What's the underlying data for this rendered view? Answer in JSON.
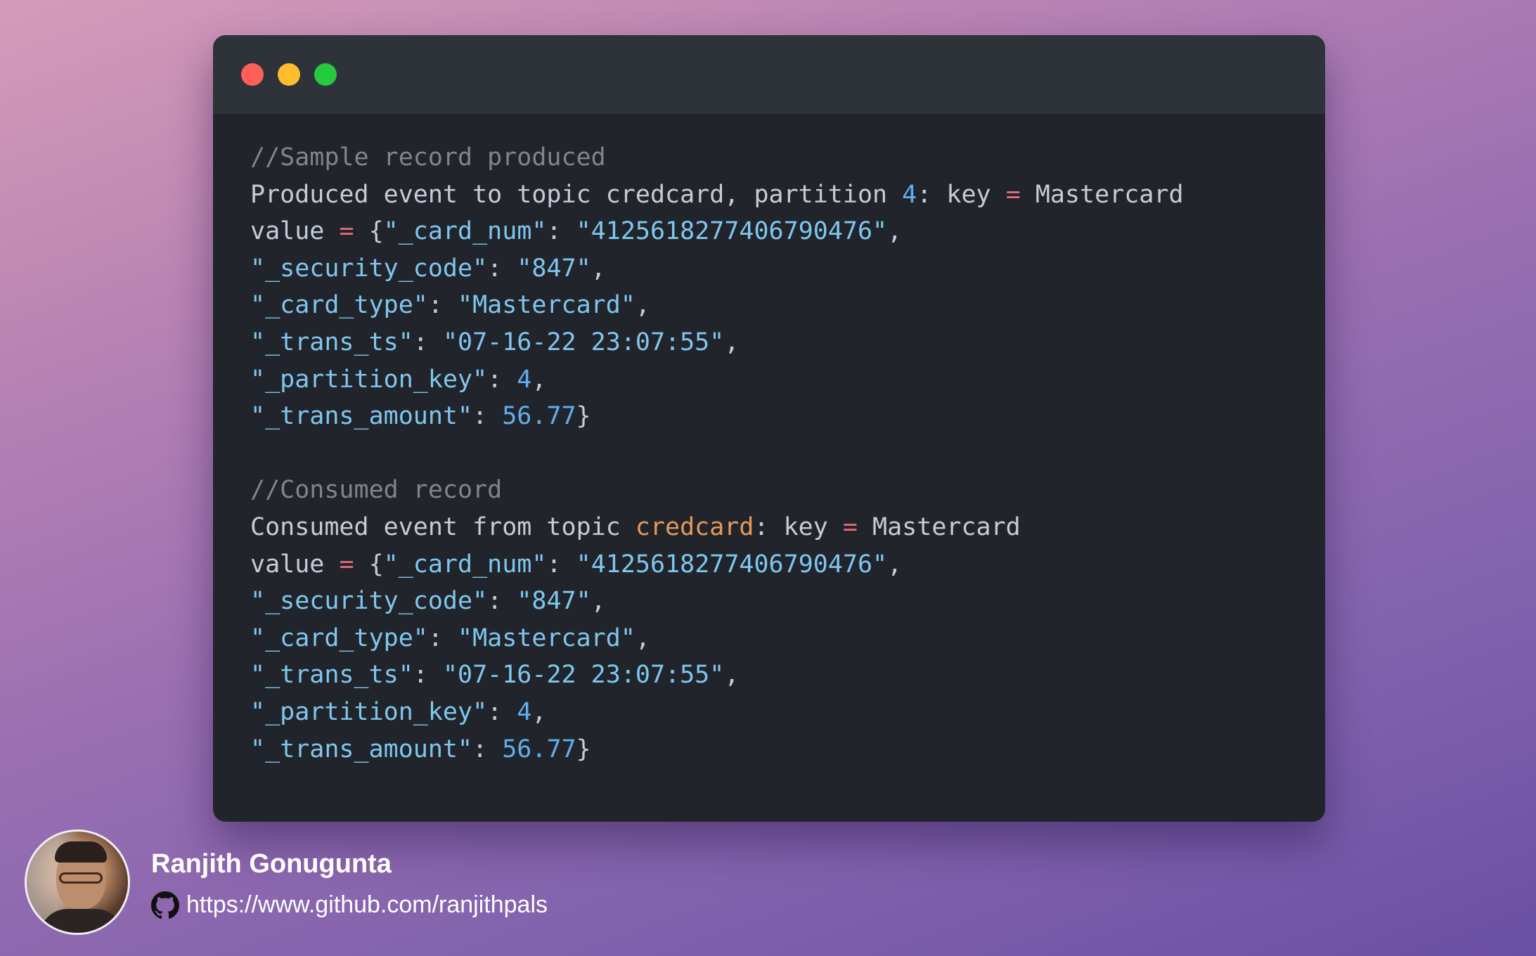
{
  "window": {
    "controls": [
      "close",
      "minimize",
      "maximize"
    ],
    "colors": {
      "close": "#ff5f56",
      "minimize": "#ffbd2e",
      "maximize": "#27c93f",
      "background": "#21252b"
    }
  },
  "code": {
    "lines": [
      [
        {
          "t": "//Sample record produced",
          "k": "c"
        }
      ],
      [
        {
          "t": "Produced event to topic credcard, partition ",
          "k": "p"
        },
        {
          "t": "4",
          "k": "n"
        },
        {
          "t": ": key ",
          "k": "p"
        },
        {
          "t": "=",
          "k": "o"
        },
        {
          "t": " Mastercard",
          "k": "p"
        }
      ],
      [
        {
          "t": "value ",
          "k": "p"
        },
        {
          "t": "=",
          "k": "o"
        },
        {
          "t": " {",
          "k": "p"
        },
        {
          "t": "\"_card_num\"",
          "k": "s"
        },
        {
          "t": ": ",
          "k": "p"
        },
        {
          "t": "\"4125618277406790476\"",
          "k": "s"
        },
        {
          "t": ",",
          "k": "p"
        }
      ],
      [
        {
          "t": "\"_security_code\"",
          "k": "s"
        },
        {
          "t": ": ",
          "k": "p"
        },
        {
          "t": "\"847\"",
          "k": "s"
        },
        {
          "t": ",",
          "k": "p"
        }
      ],
      [
        {
          "t": "\"_card_type\"",
          "k": "s"
        },
        {
          "t": ": ",
          "k": "p"
        },
        {
          "t": "\"Mastercard\"",
          "k": "s"
        },
        {
          "t": ",",
          "k": "p"
        }
      ],
      [
        {
          "t": "\"_trans_ts\"",
          "k": "s"
        },
        {
          "t": ": ",
          "k": "p"
        },
        {
          "t": "\"07-16-22 23:07:55\"",
          "k": "s"
        },
        {
          "t": ",",
          "k": "p"
        }
      ],
      [
        {
          "t": "\"_partition_key\"",
          "k": "s"
        },
        {
          "t": ": ",
          "k": "p"
        },
        {
          "t": "4",
          "k": "n"
        },
        {
          "t": ",",
          "k": "p"
        }
      ],
      [
        {
          "t": "\"_trans_amount\"",
          "k": "s"
        },
        {
          "t": ": ",
          "k": "p"
        },
        {
          "t": "56.77",
          "k": "n"
        },
        {
          "t": "}",
          "k": "p"
        }
      ],
      [],
      [
        {
          "t": "//Consumed record",
          "k": "c"
        }
      ],
      [
        {
          "t": "Consumed event from topic ",
          "k": "p"
        },
        {
          "t": "credcard",
          "k": "y"
        },
        {
          "t": ": key ",
          "k": "p"
        },
        {
          "t": "=",
          "k": "o"
        },
        {
          "t": " Mastercard",
          "k": "p"
        }
      ],
      [
        {
          "t": "value ",
          "k": "p"
        },
        {
          "t": "=",
          "k": "o"
        },
        {
          "t": " {",
          "k": "p"
        },
        {
          "t": "\"_card_num\"",
          "k": "s"
        },
        {
          "t": ": ",
          "k": "p"
        },
        {
          "t": "\"4125618277406790476\"",
          "k": "s"
        },
        {
          "t": ",",
          "k": "p"
        }
      ],
      [
        {
          "t": "\"_security_code\"",
          "k": "s"
        },
        {
          "t": ": ",
          "k": "p"
        },
        {
          "t": "\"847\"",
          "k": "s"
        },
        {
          "t": ",",
          "k": "p"
        }
      ],
      [
        {
          "t": "\"_card_type\"",
          "k": "s"
        },
        {
          "t": ": ",
          "k": "p"
        },
        {
          "t": "\"Mastercard\"",
          "k": "s"
        },
        {
          "t": ",",
          "k": "p"
        }
      ],
      [
        {
          "t": "\"_trans_ts\"",
          "k": "s"
        },
        {
          "t": ": ",
          "k": "p"
        },
        {
          "t": "\"07-16-22 23:07:55\"",
          "k": "s"
        },
        {
          "t": ",",
          "k": "p"
        }
      ],
      [
        {
          "t": "\"_partition_key\"",
          "k": "s"
        },
        {
          "t": ": ",
          "k": "p"
        },
        {
          "t": "4",
          "k": "n"
        },
        {
          "t": ",",
          "k": "p"
        }
      ],
      [
        {
          "t": "\"_trans_amount\"",
          "k": "s"
        },
        {
          "t": ": ",
          "k": "p"
        },
        {
          "t": "56.77",
          "k": "n"
        },
        {
          "t": "}",
          "k": "p"
        }
      ]
    ]
  },
  "author": {
    "name": "Ranjith Gonugunta",
    "url": "https://www.github.com/ranjithpals",
    "icon": "github-icon"
  }
}
